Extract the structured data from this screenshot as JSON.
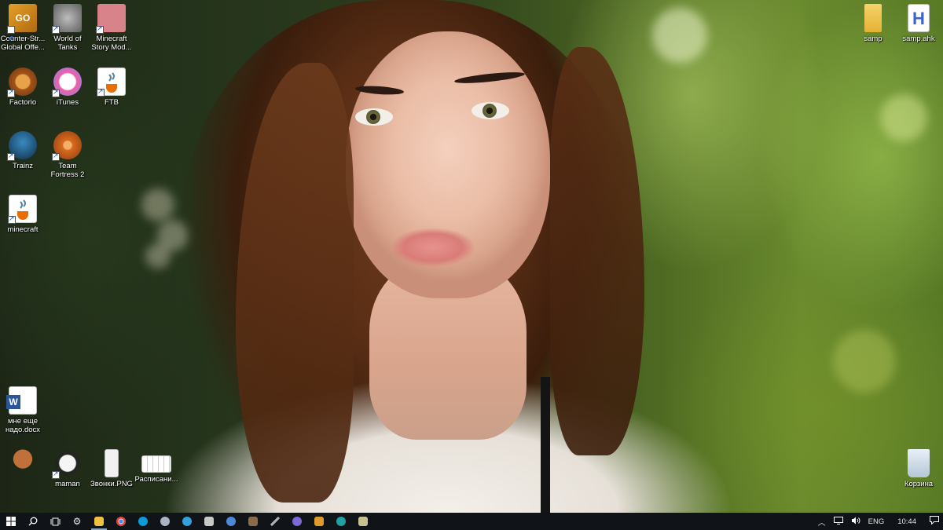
{
  "desktop": {
    "icons": [
      {
        "label": "Counter-Str... Global Offe...",
        "icon": "csgo-icon"
      },
      {
        "label": "World of Tanks",
        "icon": "world-of-tanks-icon"
      },
      {
        "label": "Minecraft Story Mod...",
        "icon": "minecraft-story-mode-icon"
      },
      {
        "label": "Factorio",
        "icon": "factorio-icon"
      },
      {
        "label": "iTunes",
        "icon": "itunes-icon"
      },
      {
        "label": "FTB",
        "icon": "java-icon"
      },
      {
        "label": "Trainz",
        "icon": "trainz-icon"
      },
      {
        "label": "Team Fortress 2",
        "icon": "tf2-icon"
      },
      {
        "label": "minecraft",
        "icon": "java-icon"
      },
      {
        "label": "мне еще надо.docx",
        "icon": "word-document-icon"
      },
      {
        "label": "",
        "icon": "bear-icon"
      },
      {
        "label": "maman",
        "icon": "trollface-icon"
      },
      {
        "label": "Звонки.PNG",
        "icon": "png-file-icon"
      },
      {
        "label": "Расписани...",
        "icon": "png-file-icon"
      },
      {
        "label": "samp",
        "icon": "folder-icon"
      },
      {
        "label": "samp.ahk",
        "icon": "ahk-script-icon"
      },
      {
        "label": "Корзина",
        "icon": "recycle-bin-icon"
      }
    ]
  },
  "taskbar": {
    "apps": [
      {
        "icon": "file-explorer-icon",
        "color": "#f0c040"
      },
      {
        "icon": "chrome-icon",
        "color": "#e04a3a"
      },
      {
        "icon": "skype-icon",
        "color": "#0c9ad8"
      },
      {
        "icon": "steam-icon",
        "color": "#aab4c0"
      },
      {
        "icon": "telegram-icon",
        "color": "#35a0dc"
      },
      {
        "icon": "app-icon",
        "color": "#c8c8c8"
      },
      {
        "icon": "globe-icon",
        "color": "#4c8ad8"
      },
      {
        "icon": "game-icon",
        "color": "#8a6a4a"
      },
      {
        "icon": "tool-icon",
        "color": "#b0b0b0"
      },
      {
        "icon": "viber-icon",
        "color": "#7d6ad6"
      },
      {
        "icon": "app-icon",
        "color": "#e09a2a"
      },
      {
        "icon": "arduino-icon",
        "color": "#20a0a0"
      },
      {
        "icon": "notepad-icon",
        "color": "#c8c090"
      }
    ],
    "tray": {
      "language": "ENG",
      "time": "10:44"
    }
  }
}
